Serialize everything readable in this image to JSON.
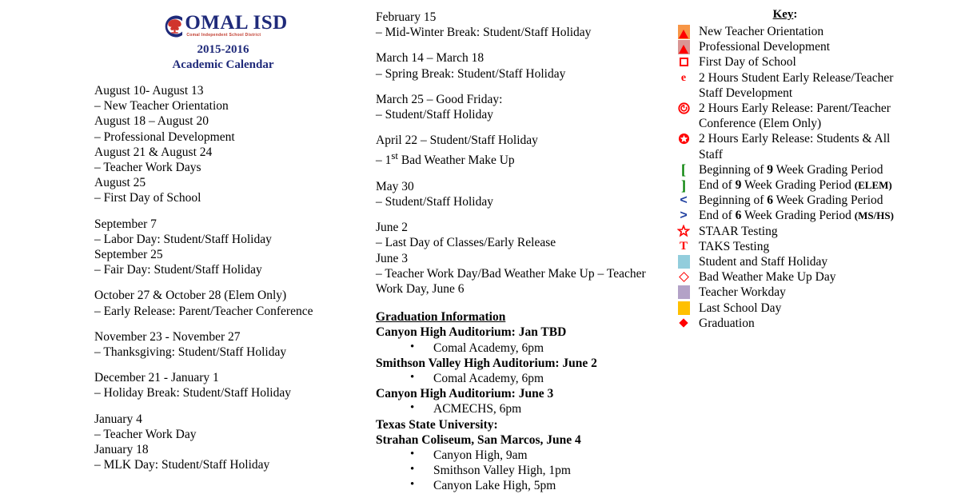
{
  "masthead": {
    "logo_letter": "C",
    "logo_main": "OMAL ISD",
    "logo_sub": "Comal Independent School District",
    "year": "2015-2016",
    "subtitle": "Academic Calendar",
    "navy": "#1F2A7A",
    "red": "#C0392B"
  },
  "left_column": {
    "entries": [
      {
        "lines": [
          "August 10- August 13",
          "– New Teacher Orientation",
          "August 18 – August 20",
          "– Professional Development",
          "August 21 & August 24",
          "– Teacher Work Days",
          "August 25",
          "– First Day of School"
        ]
      },
      {
        "lines": [
          "September 7",
          "– Labor Day: Student/Staff Holiday",
          "September 25",
          "– Fair Day: Student/Staff Holiday"
        ]
      },
      {
        "lines": [
          "October 27 & October 28 (Elem Only)",
          "– Early Release: Parent/Teacher Conference"
        ]
      },
      {
        "lines": [
          "November 23 - November 27",
          "– Thanksgiving: Student/Staff Holiday"
        ]
      },
      {
        "lines": [
          "December 21 - January 1",
          "– Holiday Break: Student/Staff Holiday"
        ]
      },
      {
        "lines": [
          "January 4",
          "– Teacher Work Day",
          "January 18",
          "– MLK Day: Student/Staff Holiday"
        ]
      }
    ]
  },
  "middle_column": {
    "entries": [
      {
        "lines": [
          "February 15",
          "– Mid-Winter Break: Student/Staff Holiday"
        ]
      },
      {
        "lines": [
          "March 14 – March 18",
          "– Spring Break: Student/Staff Holiday"
        ]
      },
      {
        "lines": [
          "March 25 – Good Friday:",
          "– Student/Staff Holiday"
        ]
      },
      {
        "lines": [
          "April 22 – Student/Staff Holiday",
          "– 1st Bad Weather Make Up"
        ],
        "superscript_line": 1
      },
      {
        "lines": [
          "May 30",
          "– Student/Staff Holiday"
        ]
      },
      {
        "lines": [
          "June 2",
          "– Last Day of Classes/Early Release",
          "June 3",
          "– Teacher Work Day/Bad Weather Make Up – Teacher Work Day, June 6"
        ],
        "wrap_last": true
      }
    ],
    "graduation": {
      "heading": "Graduation Information",
      "venues": [
        {
          "name": "Canyon High Auditorium: Jan TBD",
          "items": [
            "Comal Academy, 6pm"
          ]
        },
        {
          "name": "Smithson Valley High Auditorium:  June 2",
          "items": [
            "Comal Academy, 6pm"
          ]
        },
        {
          "name": "Canyon High Auditorium:  June 3",
          "items": [
            "ACMECHS, 6pm"
          ]
        },
        {
          "name": "Texas State University:",
          "items": []
        },
        {
          "name": "Strahan Coliseum, San Marcos, June 4",
          "items": [
            "Canyon High, 9am",
            "Smithson Valley High, 1pm",
            "Canyon Lake High, 5pm"
          ]
        }
      ],
      "bullet_glyph": "•"
    }
  },
  "key": {
    "title": "Key",
    "title_colon": ":",
    "rows": [
      {
        "icon": "orange-triangle-icon",
        "shape": "triangle",
        "bg": "#F79646",
        "fg": "#FF0000",
        "label": "New Teacher Orientation"
      },
      {
        "icon": "rose-triangle-icon",
        "shape": "triangle",
        "bg": "#D99694",
        "fg": "#FF0000",
        "label": "Professional Development"
      },
      {
        "icon": "red-square-outline-icon",
        "shape": "square-outline",
        "bg": "#FFFFFF",
        "fg": "#FF0000",
        "label": "First Day of School"
      },
      {
        "icon": "letter-e-icon",
        "shape": "glyph-e",
        "bg": "transparent",
        "fg": "#FF0000",
        "label": "2 Hours Student Early Release/Teacher",
        "label2": "Staff Development"
      },
      {
        "icon": "power-circle-icon",
        "shape": "power-circle",
        "bg": "transparent",
        "fg": "#FF0000",
        "label": "2 Hours Early Release:  Parent/Teacher",
        "label2": "Conference (Elem Only)"
      },
      {
        "icon": "star-circle-icon",
        "shape": "star-circle",
        "bg": "transparent",
        "fg": "#FF0000",
        "label": "2 Hours Early Release: Students & All",
        "label2": "Staff"
      },
      {
        "icon": "left-bracket-icon",
        "shape": "bracket-open",
        "bg": "transparent",
        "fg": "#008000",
        "label_pre": "Beginning of ",
        "label_bold": "9",
        "label_post": " Week Grading Period"
      },
      {
        "icon": "right-bracket-icon",
        "shape": "bracket-close",
        "bg": "transparent",
        "fg": "#008000",
        "label_pre": "End of ",
        "label_bold": "9",
        "label_post": " Week Grading Period ",
        "label_tag": "(ELEM)"
      },
      {
        "icon": "less-than-icon",
        "shape": "angle-left",
        "bg": "transparent",
        "fg": "#1F3FA0",
        "label_pre": " Beginning of ",
        "label_bold": "6",
        "label_post": " Week Grading Period"
      },
      {
        "icon": "greater-than-icon",
        "shape": "angle-right",
        "bg": "transparent",
        "fg": "#1F3FA0",
        "label_pre": " End of ",
        "label_bold": "6",
        "label_post": " Week Grading Period ",
        "label_tag": "(MS/HS)"
      },
      {
        "icon": "star-outline-icon",
        "shape": "star-outline",
        "bg": "transparent",
        "fg": "#FF0000",
        "label": "STAAR Testing"
      },
      {
        "icon": "letter-t-icon",
        "shape": "glyph-t",
        "bg": "transparent",
        "fg": "#FF0000",
        "label": "TAKS Testing"
      },
      {
        "icon": "lightblue-swatch-icon",
        "shape": "swatch",
        "bg": "#92CDDC",
        "fg": "#92CDDC",
        "label": "Student and Staff Holiday"
      },
      {
        "icon": "red-diamond-outline-icon",
        "shape": "diamond-outline",
        "bg": "transparent",
        "fg": "#FF0000",
        "label": "Bad Weather Make Up Day"
      },
      {
        "icon": "purple-swatch-icon",
        "shape": "swatch",
        "bg": "#B3A2C7",
        "fg": "#B3A2C7",
        "label": "Teacher Workday"
      },
      {
        "icon": "amber-swatch-icon",
        "shape": "swatch",
        "bg": "#FFC000",
        "fg": "#FFC000",
        "label": "Last School Day"
      },
      {
        "icon": "red-diamond-filled-icon",
        "shape": "diamond-filled",
        "bg": "transparent",
        "fg": "#FF0000",
        "label": "Graduation"
      }
    ]
  }
}
